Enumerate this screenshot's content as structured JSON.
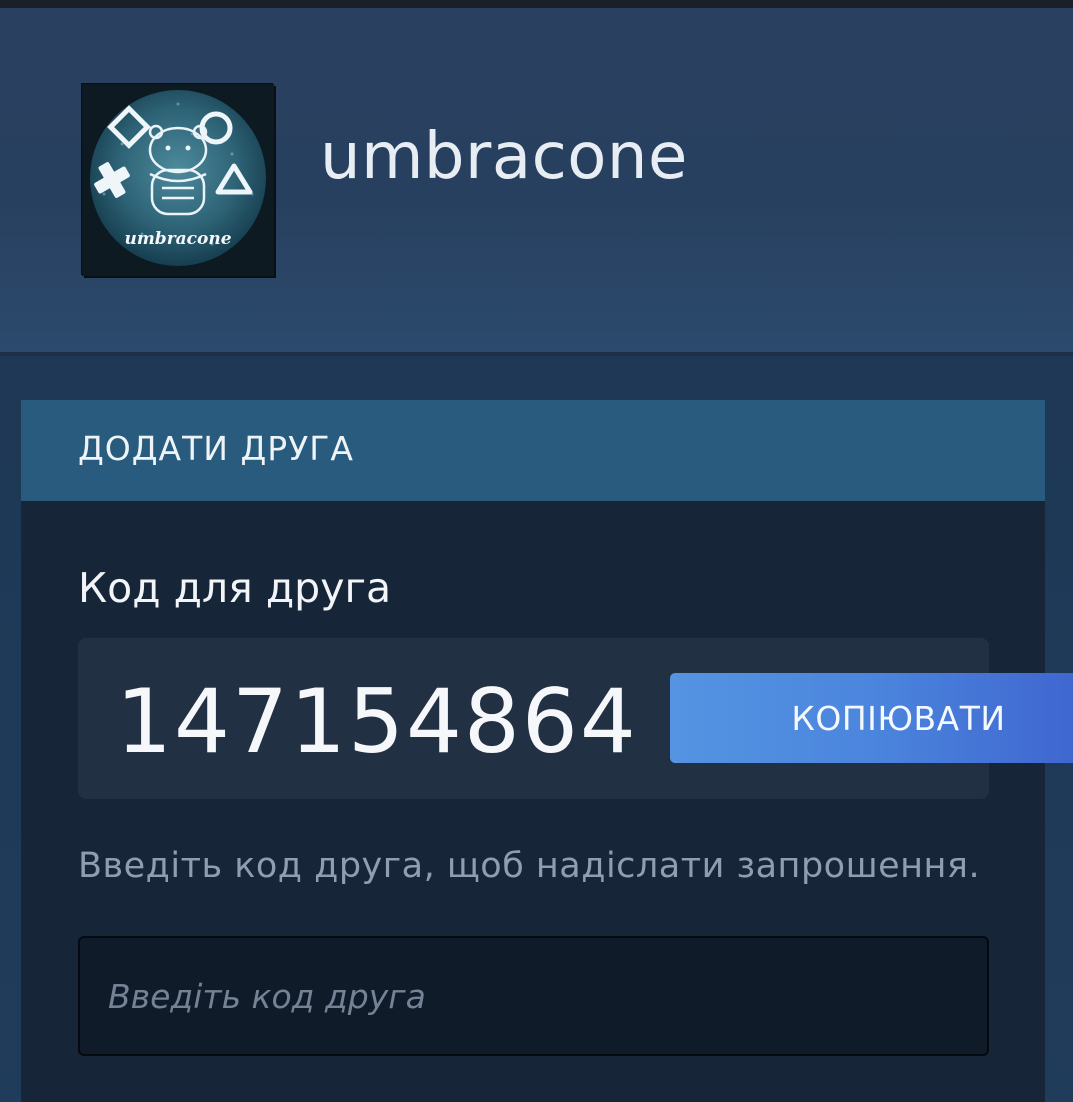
{
  "profile": {
    "username": "umbracone",
    "avatar": {
      "icon": "avatar-image",
      "caption": "umbracone"
    }
  },
  "add_friend": {
    "title": "ДОДАТИ ДРУГА",
    "code_label": "Код для друга",
    "friend_code": "147154864",
    "copy_label": "КОПІЮВАТИ",
    "hint": "Введіть код друга, щоб надіслати запрошення.",
    "input_placeholder": "Введіть код друга",
    "input_value": ""
  },
  "colors": {
    "header_bg": "#2a4060",
    "panel_title_bg": "#285b7d",
    "panel_body_bg": "#172538",
    "button_gradient_start": "#5494e2",
    "button_gradient_end": "#3f67d0"
  }
}
